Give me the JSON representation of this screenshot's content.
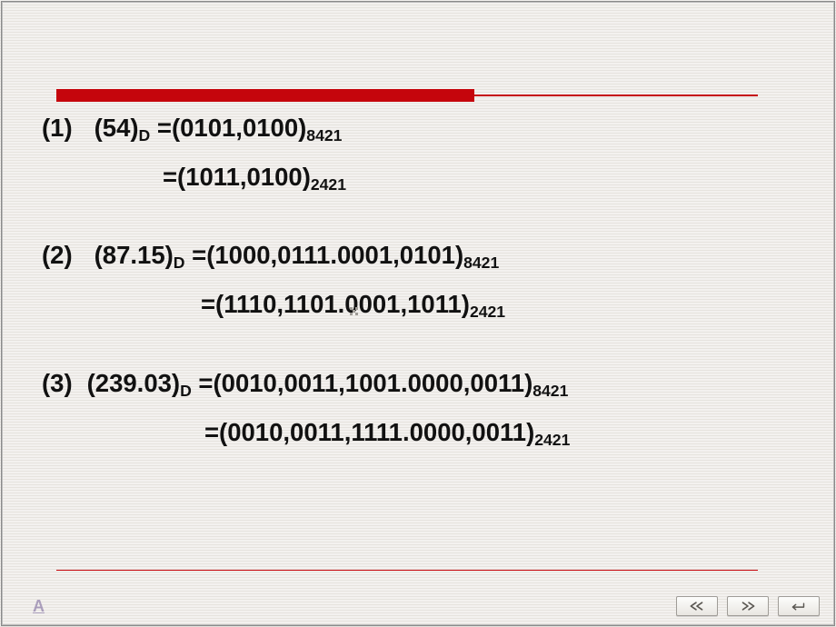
{
  "lines": {
    "r1a_num": "(1)",
    "r1a_lhs": "(54)",
    "r1a_lsub": "D",
    "r1a_eq": " =(0101,0100)",
    "r1a_rsub": "8421",
    "r1b_eq": "=(1011,0100)",
    "r1b_rsub": "2421",
    "r2a_num": "(2)",
    "r2a_lhs": "(87.15)",
    "r2a_lsub": "D",
    "r2a_eq": " =(1000,0111.0001,0101)",
    "r2a_rsub": "8421",
    "r2b_eq": "=(1110,1101.0001,1011)",
    "r2b_rsub": "2421",
    "r3a_num": "(3)",
    "r3a_lhs": "(239.03)",
    "r3a_lsub": "D",
    "r3a_eq": " =(0010,0011,1001.0000,0011)",
    "r3a_rsub": "8421",
    "r3b_eq": "=(0010,0011,1111.0000,0011)",
    "r3b_rsub": "2421"
  },
  "nav": {
    "prev": "previous",
    "next": "next",
    "back": "back"
  },
  "corner_mark": "A"
}
